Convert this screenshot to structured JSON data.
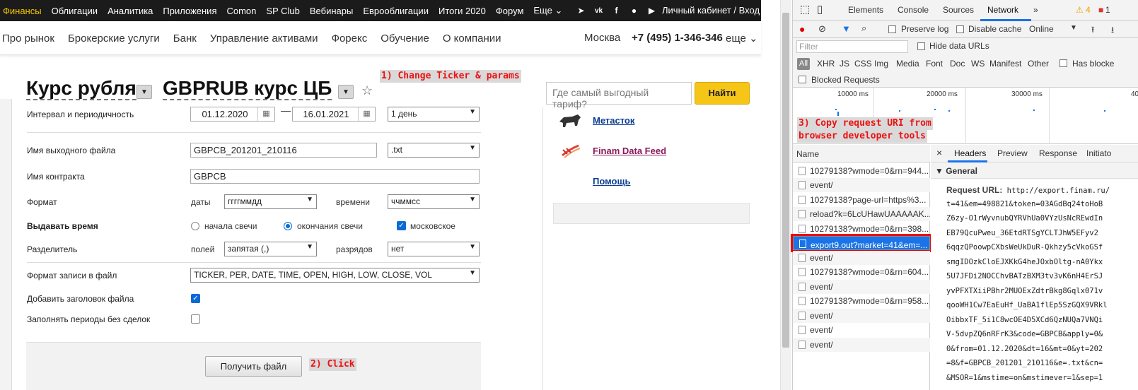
{
  "topbar": {
    "items": [
      "Финансы",
      "Облигации",
      "Аналитика",
      "Приложения",
      "Comon",
      "SP Club",
      "Вебинары",
      "Еврооблигации",
      "Итоги 2020",
      "Форум",
      "Еще ⌄"
    ],
    "cabinet": "Личный кабинет / Вход"
  },
  "mainnav": {
    "items": [
      "Про рынок",
      "Брокерские услуги",
      "Банк",
      "Управление активами",
      "Форекс",
      "Обучение",
      "О компании"
    ],
    "city": "Москва",
    "phone": "+7 (495) 1-346-346",
    "more": "еще ⌄"
  },
  "header": {
    "title1": "Курс рубля",
    "title2": "GBPRUB курс ЦБ"
  },
  "annotations": {
    "a1": "1) Change Ticker & params",
    "a2": "2) Click",
    "a3_line1": "3) Copy request URI from",
    "a3_line2": "browser developer tools"
  },
  "search": {
    "placeholder": "Где самый выгодный тариф?",
    "button": "Найти"
  },
  "form": {
    "interval_label": "Интервал и периодичность",
    "date_from": "01.12.2020",
    "date_to": "16.01.2021",
    "period": "1 день",
    "outfile_label": "Имя выходного файла",
    "outfile": "GBPCB_201201_210116",
    "ext": ".txt",
    "contract_label": "Имя контракта",
    "contract": "GBPCB",
    "format_label": "Формат",
    "date_sub": "даты",
    "date_format": "ггггммдд",
    "time_sub": "времени",
    "time_format": "ччммсс",
    "issue_time_label": "Выдавать время",
    "candle_start": "начала свечи",
    "candle_end": "окончания свечи",
    "moscow": "московское",
    "separator_label": "Разделитель",
    "fields_sub": "полей",
    "fields_sep": "запятая (,)",
    "digits_sub": "разрядов",
    "digits_sep": "нет",
    "record_label": "Формат записи в файл",
    "record_format": "TICKER, PER, DATE, TIME, OPEN, HIGH, LOW, CLOSE, VOL",
    "add_header_label": "Добавить заголовок файла",
    "fill_periods_label": "Заполнять периоды без сделок",
    "submit": "Получить файл"
  },
  "sidebar": {
    "metastock": "Метасток",
    "feed": "Finam Data Feed",
    "help": "Помощь"
  },
  "devtools": {
    "tabs": [
      "Elements",
      "Console",
      "Sources",
      "Network",
      "»"
    ],
    "warnings": "⚠ 4",
    "errors": "1",
    "preserve_log": "Preserve log",
    "disable_cache": "Disable cache",
    "online": "Online",
    "filter_placeholder": "Filter",
    "hide_data_urls": "Hide data URLs",
    "types": [
      "All",
      "XHR",
      "JS",
      "CSS",
      "Img",
      "Media",
      "Font",
      "Doc",
      "WS",
      "Manifest",
      "Other"
    ],
    "has_blocked": "Has blocke",
    "blocked_requests": "Blocked Requests",
    "timeline_labels": [
      "10000 ms",
      "20000 ms",
      "30000 ms",
      "40"
    ],
    "name_header": "Name",
    "requests": [
      "10279138?wmode=0&rn=944...",
      "event/",
      "10279138?page-url=https%3...",
      "reload?k=6LcUHawUAAAAAK...",
      "10279138?wmode=0&rn=398...",
      "export9.out?market=41&em=...",
      "event/",
      "10279138?wmode=0&rn=604...",
      "event/",
      "10279138?wmode=0&rn=958...",
      "event/",
      "event/",
      "event/"
    ],
    "detail_close": "×",
    "detail_tabs": [
      "Headers",
      "Preview",
      "Response",
      "Initiato"
    ],
    "general": "▼ General",
    "request_url_label": "Request URL:",
    "url_lines": [
      "http://export.finam.ru/",
      "t=41&em=498821&token=03AGdBq24toHoB",
      "Z6zy-O1rWyvnubQYRVhUa0VYzUsNcREwdIn",
      "EB79QcuPweu_36EtdRTSgYCLTJhW5EFyv2",
      "6qqzQPoowpCXbsWeUkDuR-Qkhzy5cVkoGSf",
      "smgIDOzkCloEJXKkG4heJOxbOltg-nA0Ykx",
      "5U7JFDi2NOCChvBATzBXM3tv3vK6nH4ErSJ",
      "yvPFXTXiiPBhr2MUOExZdtrBkg8Gqlx071v",
      "qooWH1Cw7EaEuHf_UaBA1flEp5SzGQX9VRkl",
      "OibbxTF_5i1C8wcOE4D5XCd6QzNUQa7VNQi",
      "V-5dvpZQ6nRFrK3&code=GBPCB&apply=0&",
      "0&from=01.12.2020&dt=16&mt=0&yt=202",
      "=8&f=GBPCB_201201_210116&e=.txt&cn=",
      "&MSOR=1&mstime=on&mstimever=1&sep=1"
    ]
  }
}
